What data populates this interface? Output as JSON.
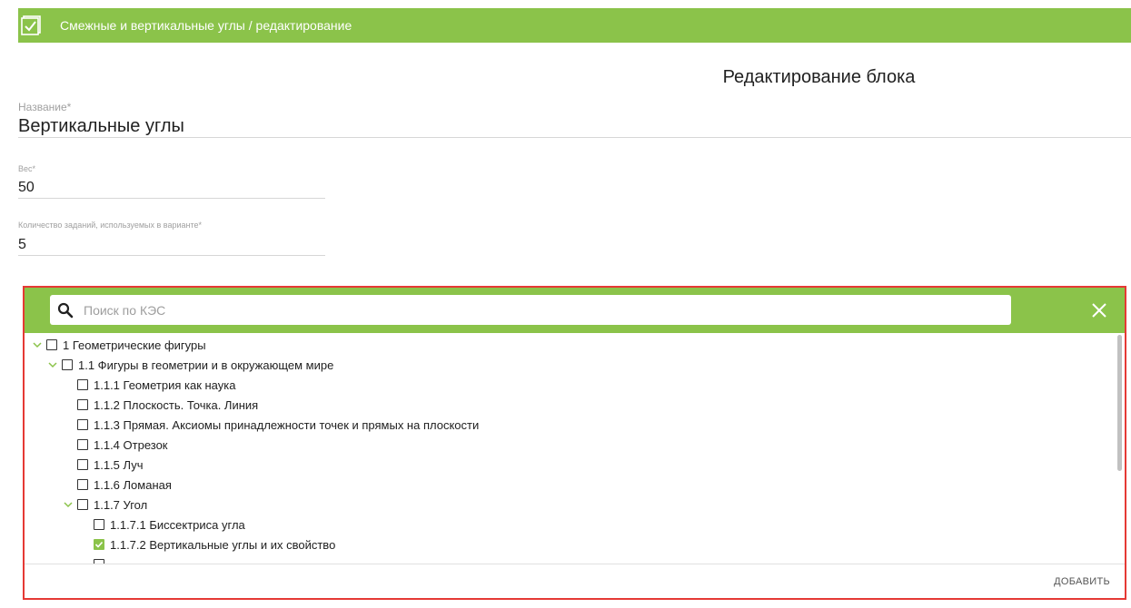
{
  "header": {
    "title": "Смежные и вертикальные углы / редактирование",
    "logo_icon": "checkbox-logo-icon"
  },
  "page": {
    "title": "Редактирование блока"
  },
  "form": {
    "name": {
      "label": "Название*",
      "value": "Вертикальные углы"
    },
    "weight": {
      "label": "Вес*",
      "value": "50"
    },
    "tasks_count": {
      "label": "Количество заданий, используемых в варианте*",
      "value": "5"
    }
  },
  "kes_panel": {
    "search_placeholder": "Поиск по КЭС",
    "search_value": "",
    "close_icon": "close-icon",
    "add_label": "ДОБАВИТЬ",
    "tree": [
      {
        "label": "1 Геометрические фигуры",
        "level": 0,
        "expanded": true,
        "checked": false
      },
      {
        "label": "1.1 Фигуры в геометрии и в окружающем мире",
        "level": 1,
        "expanded": true,
        "checked": false
      },
      {
        "label": "1.1.1 Геометрия как наука",
        "level": 2,
        "checked": false
      },
      {
        "label": "1.1.2 Плоскость. Точка. Линия",
        "level": 2,
        "checked": false
      },
      {
        "label": "1.1.3 Прямая. Аксиомы принадлежности точек и прямых на плоскости",
        "level": 2,
        "checked": false
      },
      {
        "label": "1.1.4 Отрезок",
        "level": 2,
        "checked": false
      },
      {
        "label": "1.1.5 Луч",
        "level": 2,
        "checked": false
      },
      {
        "label": "1.1.6 Ломаная",
        "level": 2,
        "checked": false
      },
      {
        "label": "1.1.7 Угол",
        "level": 2,
        "expanded": true,
        "checked": false
      },
      {
        "label": "1.1.7.1 Биссектриса угла",
        "level": 3,
        "checked": false
      },
      {
        "label": "1.1.7.2 Вертикальные углы и их свойство",
        "level": 3,
        "checked": true
      }
    ]
  },
  "colors": {
    "accent": "#8bc34a",
    "highlight_border": "#e53935"
  }
}
